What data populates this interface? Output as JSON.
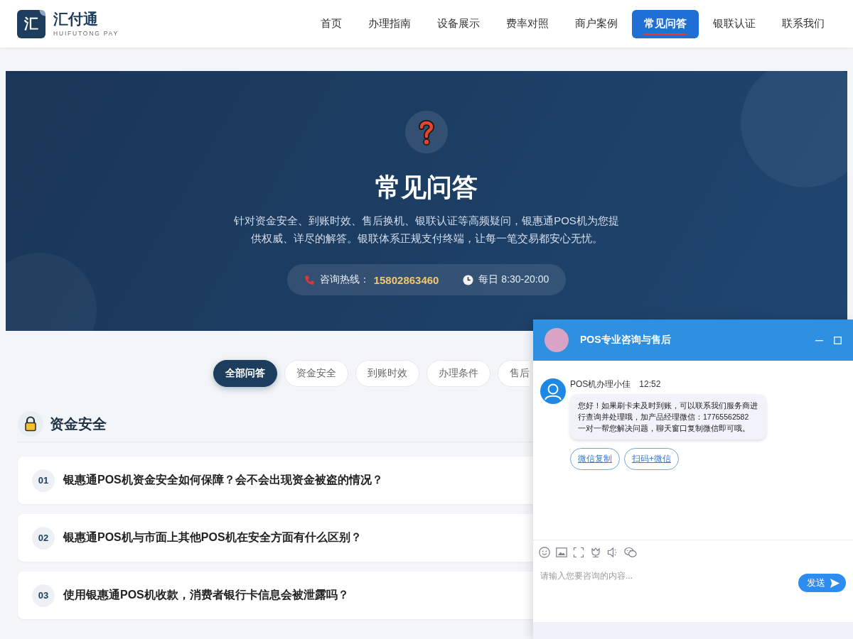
{
  "header": {
    "logo": {
      "mark": "汇",
      "name": "汇付通",
      "tagline": "HUIFUTONG PAY"
    },
    "nav": [
      {
        "label": "首页",
        "selected": false
      },
      {
        "label": "办理指南",
        "selected": false
      },
      {
        "label": "设备展示",
        "selected": false
      },
      {
        "label": "费率对照",
        "selected": false
      },
      {
        "label": "商户案例",
        "selected": false
      },
      {
        "label": "常见问答",
        "selected": true
      },
      {
        "label": "银联认证",
        "selected": false
      },
      {
        "label": "联系我们",
        "selected": false
      }
    ]
  },
  "hero": {
    "title": "常见问答",
    "description": "针对资金安全、到账时效、售后换机、银联认证等高频疑问，银惠通POS机为您提供权威、详尽的解答。银联体系正规支付终端，让每一笔交易都安心无忧。",
    "contact": {
      "hotline_label": "咨询热线：",
      "hotline": "15802863460",
      "hours": "每日 8:30-20:00"
    }
  },
  "filters": [
    {
      "label": "全部问答",
      "selected": true
    },
    {
      "label": "资金安全",
      "selected": false
    },
    {
      "label": "到账时效",
      "selected": false
    },
    {
      "label": "办理条件",
      "selected": false
    },
    {
      "label": "售后",
      "selected": false
    }
  ],
  "section": {
    "title": "资金安全",
    "questions": [
      {
        "number": "01",
        "text": "银惠通POS机资金安全如何保障？会不会出现资金被盗的情况？"
      },
      {
        "number": "02",
        "text": "银惠通POS机与市面上其他POS机在安全方面有什么区别？"
      },
      {
        "number": "03",
        "text": "使用银惠通POS机收款，消费者银行卡信息会被泄露吗？"
      }
    ]
  },
  "chat": {
    "title": "POS专业咨询与售后",
    "message": {
      "sender": "POS机办理小佳",
      "time": "12:52",
      "text": "您好！如果刷卡未及时到账，可以联系我们服务商进行查询并处理哦，加产品经理微信：17765562582 一对一帮您解决问题，聊天窗口复制微信即可哦。",
      "actions": [
        "微信复制",
        "扫码+微信"
      ]
    },
    "input": {
      "placeholder": "请输入您要咨询的内容..."
    },
    "send_button": "发送"
  }
}
